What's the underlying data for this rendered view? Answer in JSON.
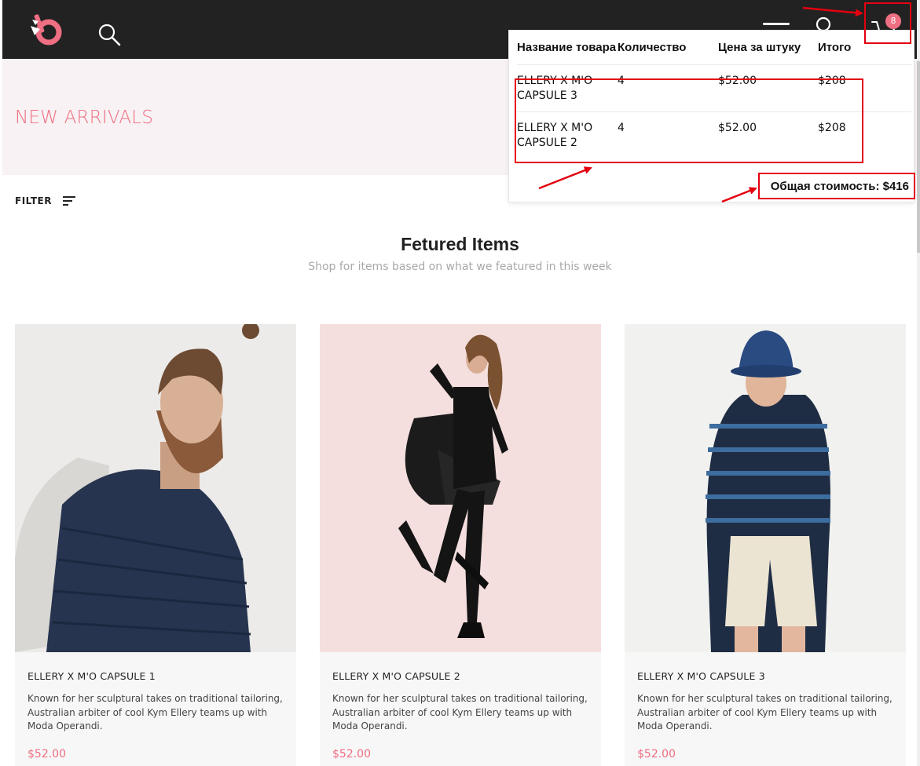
{
  "header": {
    "cart_count": "8"
  },
  "hero": {
    "title": "NEW ARRIVALS"
  },
  "filter": {
    "label": "FILTER"
  },
  "section": {
    "title": "Fetured Items",
    "subtitle": "Shop for items based on what we featured in this week"
  },
  "products": [
    {
      "name": "ELLERY X M'O CAPSULE 1",
      "description": "Known for her sculptural takes on traditional tailoring, Australian arbiter of cool Kym Ellery teams up with Moda Operandi.",
      "price": "$52.00"
    },
    {
      "name": "ELLERY X M'O CAPSULE 2",
      "description": "Known for her sculptural takes on traditional tailoring, Australian arbiter of cool Kym Ellery teams up with Moda Operandi.",
      "price": "$52.00"
    },
    {
      "name": "ELLERY X M'O CAPSULE 3",
      "description": "Known for her sculptural takes on traditional tailoring, Australian arbiter of cool Kym Ellery teams up with Moda Operandi.",
      "price": "$52.00"
    }
  ],
  "cart": {
    "headers": [
      "Название товара",
      "Количество",
      "Цена за штуку",
      "Итого"
    ],
    "rows": [
      [
        "ELLERY X M'O CAPSULE 3",
        "4",
        "$52.00",
        "$208"
      ],
      [
        "ELLERY X M'O CAPSULE 2",
        "4",
        "$52.00",
        "$208"
      ]
    ],
    "total_label": "Общая стоимость:",
    "total_value": "$416"
  },
  "colors": {
    "accent": "#ee6e82",
    "header_bg": "#222222",
    "hero_bg": "#f8f2f4",
    "annotation": "#e3000f"
  }
}
